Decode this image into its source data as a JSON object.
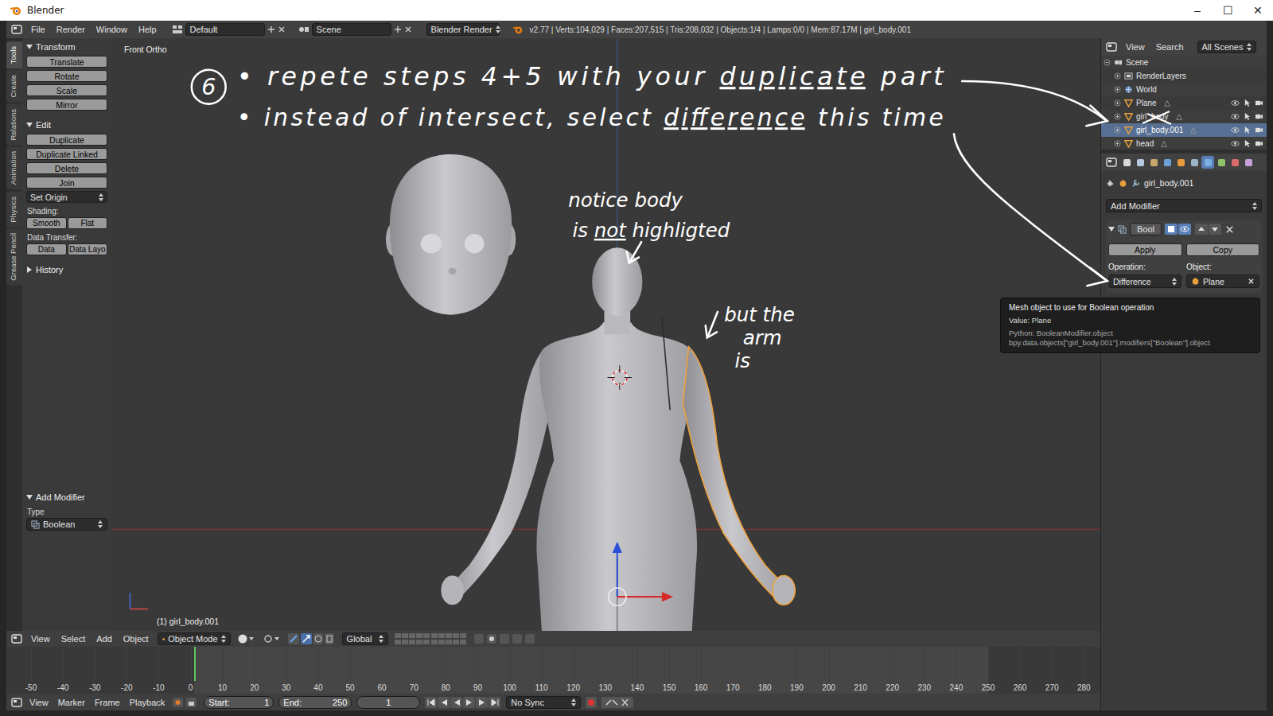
{
  "window": {
    "title": "Blender",
    "controls": [
      "–",
      "☐",
      "✕"
    ]
  },
  "info_header": {
    "menus": [
      "File",
      "Render",
      "Window",
      "Help"
    ],
    "layout": "Default",
    "scene": "Scene",
    "engine": "Blender Render",
    "stats": "v2.77 | Verts:104,029 | Faces:207,515 | Tris:208,032 | Objects:1/4 | Lamps:0/0 | Mem:87.17M | girl_body.001"
  },
  "tool_tabs": [
    {
      "label": "Tools",
      "selected": true
    },
    {
      "label": "Create",
      "selected": false
    },
    {
      "label": "Relations",
      "selected": false
    },
    {
      "label": "Animation",
      "selected": false
    },
    {
      "label": "Physics",
      "selected": false
    },
    {
      "label": "Grease Pencil",
      "selected": false
    }
  ],
  "toolshelf": {
    "panels": [
      {
        "title": "Transform",
        "expanded": true,
        "items": [
          {
            "kind": "button",
            "labels": [
              "Translate"
            ]
          },
          {
            "kind": "button",
            "labels": [
              "Rotate"
            ]
          },
          {
            "kind": "button",
            "labels": [
              "Scale"
            ]
          },
          {
            "kind": "button",
            "labels": [
              "Mirror"
            ]
          }
        ]
      },
      {
        "title": "Edit",
        "expanded": true,
        "items": [
          {
            "kind": "button",
            "labels": [
              "Duplicate"
            ]
          },
          {
            "kind": "button",
            "labels": [
              "Duplicate Linked"
            ]
          },
          {
            "kind": "button",
            "labels": [
              "Delete"
            ]
          },
          {
            "kind": "button",
            "labels": [
              "Join"
            ]
          },
          {
            "kind": "dropdown",
            "labels": [
              "Set Origin"
            ]
          },
          {
            "kind": "label",
            "labels": [
              "Shading:"
            ]
          },
          {
            "kind": "button",
            "labels": [
              "Smooth",
              "Flat"
            ]
          },
          {
            "kind": "label",
            "labels": [
              "Data Transfer:"
            ]
          },
          {
            "kind": "button",
            "labels": [
              "Data",
              "Data Layo"
            ]
          }
        ]
      },
      {
        "title": "History",
        "expanded": false,
        "items": []
      }
    ]
  },
  "operator_panel": {
    "title": "Add Modifier",
    "expanded": true,
    "field_label": "Type",
    "value": "Boolean"
  },
  "viewport": {
    "view_name": "Front Ortho",
    "object_label": "(1) girl_body.001"
  },
  "annotations": {
    "step": "6",
    "lines": [
      {
        "parts": [
          {
            "text": "• repete steps 4+5 with your ",
            "underline": false
          },
          {
            "text": "duplicate",
            "underline": true
          },
          {
            "text": " part",
            "underline": false
          }
        ]
      },
      {
        "parts": [
          {
            "text": "• instead of intersect, select ",
            "underline": false
          },
          {
            "text": "difference",
            "underline": true
          },
          {
            "text": " this time",
            "underline": false
          }
        ]
      }
    ],
    "notes": [
      {
        "lines": [
          {
            "parts": [
              {
                "text": "notice body",
                "underline": false
              }
            ]
          },
          {
            "parts": [
              {
                "text": "is ",
                "underline": false
              },
              {
                "text": "not",
                "underline": true
              },
              {
                "text": " highligted",
                "underline": false
              }
            ]
          }
        ]
      },
      {
        "lines": [
          {
            "parts": [
              {
                "text": "but the",
                "underline": false
              }
            ]
          },
          {
            "parts": [
              {
                "text": "arm",
                "underline": false
              }
            ]
          },
          {
            "parts": [
              {
                "text": "is",
                "underline": false
              }
            ]
          }
        ]
      }
    ]
  },
  "outliner": {
    "menus": [
      "View",
      "Search"
    ],
    "filter": "All Scenes",
    "items": [
      {
        "name": "Scene",
        "depth": 0,
        "kind": "scene",
        "expanded": true,
        "selected": false,
        "crossed_out": false
      },
      {
        "name": "RenderLayers",
        "depth": 1,
        "kind": "renderlayers",
        "expanded": false,
        "selected": false,
        "crossed_out": false
      },
      {
        "name": "World",
        "depth": 1,
        "kind": "world",
        "expanded": false,
        "selected": false,
        "crossed_out": false
      },
      {
        "name": "Plane",
        "depth": 1,
        "kind": "object",
        "expanded": false,
        "selected": false,
        "crossed_out": false
      },
      {
        "name": "girl_body",
        "depth": 1,
        "kind": "object",
        "expanded": false,
        "selected": false,
        "crossed_out": true
      },
      {
        "name": "girl_body.001",
        "depth": 1,
        "kind": "object",
        "expanded": false,
        "selected": true,
        "crossed_out": false
      },
      {
        "name": "head",
        "depth": 1,
        "kind": "object",
        "expanded": false,
        "selected": false,
        "crossed_out": false
      }
    ]
  },
  "properties": {
    "context_tabs": [
      {
        "selected": false
      },
      {
        "selected": false
      },
      {
        "selected": false
      },
      {
        "selected": false
      },
      {
        "selected": false
      },
      {
        "selected": false
      },
      {
        "selected": true
      },
      {
        "selected": false
      },
      {
        "selected": false
      },
      {
        "selected": false
      }
    ],
    "object": "girl_body.001",
    "add_modifier": "Add Modifier",
    "modifier": {
      "name": "Bool",
      "expanded": true,
      "apply": "Apply",
      "copy": "Copy",
      "operation_label": "Operation:",
      "operation": "Difference",
      "object_label": "Object:",
      "object": "Plane"
    }
  },
  "tooltip": {
    "title": "Mesh object to use for Boolean operation",
    "value": "Value: Plane",
    "python": [
      "Python: BooleanModifier.object",
      "bpy.data.objects[\"girl_body.001\"].modifiers[\"Boolean\"].object"
    ]
  },
  "view3d_header": {
    "menus": [
      "View",
      "Select",
      "Add",
      "Object"
    ],
    "mode": "Object Mode",
    "orientation": "Global"
  },
  "timeline": {
    "ticks": [
      "-50",
      "-40",
      "-30",
      "-20",
      "-10",
      "0",
      "10",
      "20",
      "30",
      "40",
      "50",
      "60",
      "70",
      "80",
      "90",
      "100",
      "110",
      "120",
      "130",
      "140",
      "150",
      "160",
      "170",
      "180",
      "190",
      "200",
      "210",
      "220",
      "230",
      "240",
      "250",
      "260",
      "270",
      "280"
    ]
  },
  "timeline_header": {
    "menus": [
      "View",
      "Marker",
      "Frame",
      "Playback"
    ],
    "start_label": "Start:",
    "start": "1",
    "end_label": "End:",
    "end": "250",
    "frame": "1",
    "sync": "No Sync"
  }
}
